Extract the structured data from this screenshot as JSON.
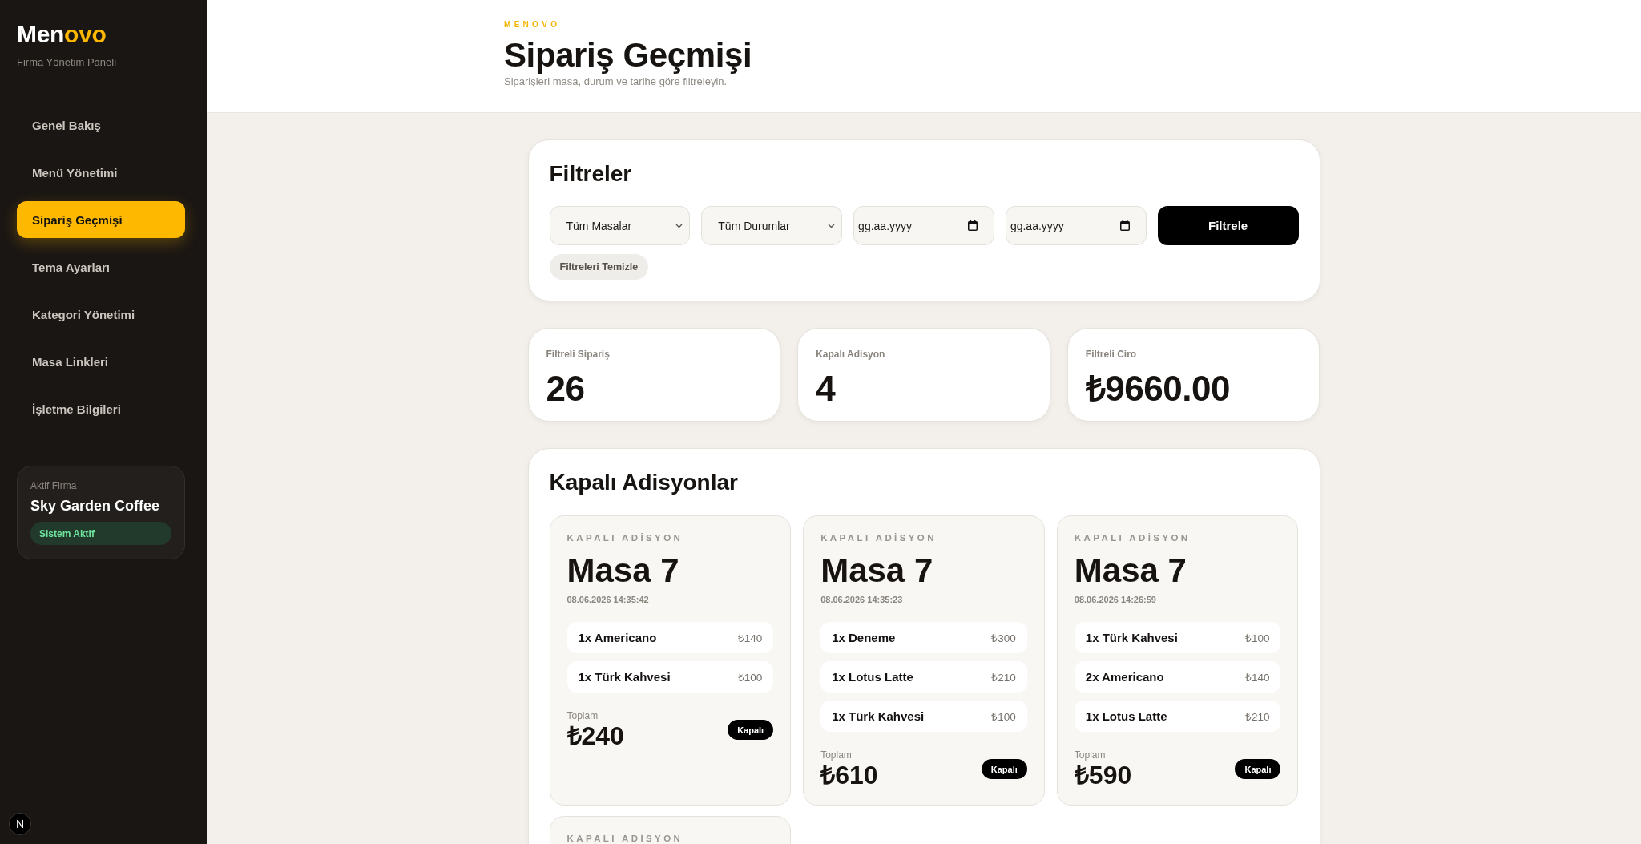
{
  "sidebar": {
    "logo": {
      "lead": "Men",
      "accent": "ovo"
    },
    "subtitle": "Firma Yönetim Paneli",
    "nav": [
      {
        "label": "Genel Bakış",
        "selected": false
      },
      {
        "label": "Menü Yönetimi",
        "selected": false
      },
      {
        "label": "Sipariş Geçmişi",
        "selected": true
      },
      {
        "label": "Tema Ayarları",
        "selected": false
      },
      {
        "label": "Kategori Yönetimi",
        "selected": false
      },
      {
        "label": "Masa Linkleri",
        "selected": false
      },
      {
        "label": "İşletme Bilgileri",
        "selected": false
      }
    ],
    "active_firm": {
      "label": "Aktif Firma",
      "name": "Sky Garden Coffee",
      "status": "Sistem Aktif"
    },
    "floating_badge": "N"
  },
  "header": {
    "eyebrow": "MENOVO",
    "title": "Sipariş Geçmişi",
    "subtitle": "Siparişleri masa, durum ve tarihe göre filtreleyin."
  },
  "filters": {
    "title": "Filtreler",
    "controls": [
      {
        "kind": "select",
        "value": "Tüm Masalar"
      },
      {
        "kind": "select",
        "value": "Tüm Durumlar"
      },
      {
        "kind": "date",
        "placeholder": "gg.aa.yyyy"
      },
      {
        "kind": "date",
        "placeholder": "gg.aa.yyyy"
      }
    ],
    "submit": "Filtrele",
    "clear": "Filtreleri Temizle"
  },
  "stats": [
    {
      "label": "Filtreli Sipariş",
      "value": "26"
    },
    {
      "label": "Kapalı Adisyon",
      "value": "4"
    },
    {
      "label": "Filtreli Ciro",
      "value": "₺9660.00"
    }
  ],
  "closed_bills": {
    "title": "Kapalı Adisyonlar",
    "cards": [
      {
        "label": "KAPALI ADİSYON",
        "table": "Masa 7",
        "time": "08.06.2026 14:35:42",
        "items": [
          {
            "name": "1x Americano",
            "price": "₺140"
          },
          {
            "name": "1x Türk Kahvesi",
            "price": "₺100"
          }
        ],
        "total_label": "Toplam",
        "total": "₺240",
        "status": "Kapalı"
      },
      {
        "label": "KAPALI ADİSYON",
        "table": "Masa 7",
        "time": "08.06.2026 14:35:23",
        "items": [
          {
            "name": "1x Deneme",
            "price": "₺300"
          },
          {
            "name": "1x Lotus Latte",
            "price": "₺210"
          },
          {
            "name": "1x Türk Kahvesi",
            "price": "₺100"
          }
        ],
        "total_label": "Toplam",
        "total": "₺610",
        "status": "Kapalı"
      },
      {
        "label": "KAPALI ADİSYON",
        "table": "Masa 7",
        "time": "08.06.2026 14:26:59",
        "items": [
          {
            "name": "1x Türk Kahvesi",
            "price": "₺100"
          },
          {
            "name": "2x Americano",
            "price": "₺140"
          },
          {
            "name": "1x Lotus Latte",
            "price": "₺210"
          }
        ],
        "total_label": "Toplam",
        "total": "₺590",
        "status": "Kapalı"
      },
      {
        "label": "KAPALI ADİSYON"
      }
    ]
  }
}
